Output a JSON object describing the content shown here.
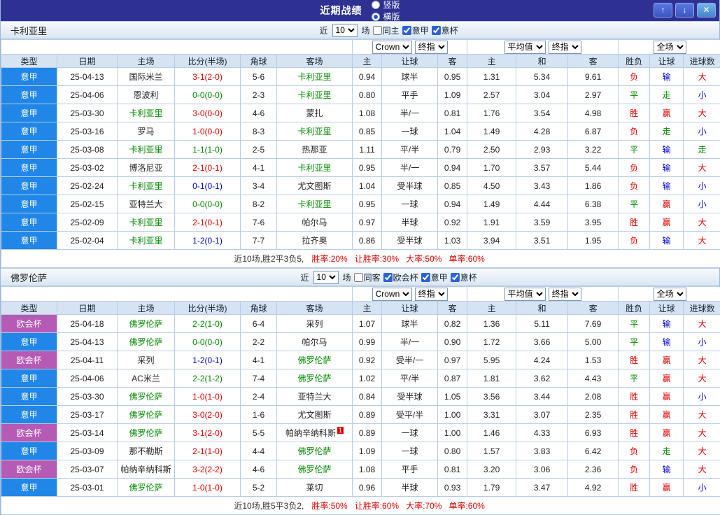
{
  "colors": {
    "titlebar_bg": "#2e3192",
    "header_bg": "#d6e3f2",
    "league_bg": {
      "意甲": "#2086e8",
      "欧会杯": "#b55ab5"
    },
    "win_red": "#e00000",
    "draw_green": "#008800",
    "lose_blue": "#0000cc"
  },
  "titlebar": {
    "title": "近期战绩",
    "radios": [
      {
        "name": "layout-vertical-radio",
        "label": "竖版",
        "selected": false
      },
      {
        "name": "layout-horizontal-radio",
        "label": "横版",
        "selected": true
      }
    ],
    "buttons": [
      {
        "name": "move-up-button",
        "icon": "up-arrow-icon",
        "glyph": "↑"
      },
      {
        "name": "move-down-button",
        "icon": "down-arrow-icon",
        "glyph": "↓"
      },
      {
        "name": "close-button",
        "icon": "close-icon",
        "glyph": "✕"
      }
    ]
  },
  "columns": [
    "类型",
    "日期",
    "主场",
    "比分(半场)",
    "角球",
    "客场",
    "主",
    "让球",
    "客",
    "主",
    "和",
    "客",
    "胜负",
    "让球",
    "进球数"
  ],
  "sections": [
    {
      "team": "卡利亚里",
      "controls": {
        "near_label": "近",
        "count": "10",
        "unit_label": "场",
        "checkboxes": [
          {
            "name": "same-home-checkbox",
            "label": "同主",
            "checked": false
          },
          {
            "name": "serie-a-checkbox",
            "label": "意甲",
            "checked": true
          },
          {
            "name": "italy-cup-checkbox",
            "label": "意杯",
            "checked": true
          }
        ]
      },
      "dropdowns": {
        "asian_source": "Crown",
        "asian_time": "终指",
        "euro_source": "平均值",
        "euro_time": "终指",
        "scope": "全场"
      },
      "rows": [
        {
          "league": "意甲",
          "date": "25-04-13",
          "home": "国际米兰",
          "home_focus": false,
          "score": "3-1(2-0)",
          "score_color": "red",
          "corners": "5-6",
          "away": "卡利亚里",
          "away_focus": true,
          "ah": [
            "0.94",
            "球半",
            "0.95"
          ],
          "eu": [
            "1.31",
            "5.34",
            "9.61"
          ],
          "result": [
            "负",
            "red"
          ],
          "handicap": [
            "输",
            "blue"
          ],
          "goals": [
            "大",
            "red"
          ]
        },
        {
          "league": "意甲",
          "date": "25-04-06",
          "home": "恩波利",
          "home_focus": false,
          "score": "0-0(0-0)",
          "score_color": "green",
          "corners": "2-3",
          "away": "卡利亚里",
          "away_focus": true,
          "ah": [
            "0.80",
            "平手",
            "1.09"
          ],
          "eu": [
            "2.57",
            "3.04",
            "2.97"
          ],
          "result": [
            "平",
            "green"
          ],
          "handicap": [
            "走",
            "green"
          ],
          "goals": [
            "小",
            "blue"
          ]
        },
        {
          "league": "意甲",
          "date": "25-03-30",
          "home": "卡利亚里",
          "home_focus": true,
          "score": "3-0(0-0)",
          "score_color": "red",
          "corners": "4-6",
          "away": "蒙扎",
          "away_focus": false,
          "ah": [
            "1.08",
            "半/一",
            "0.81"
          ],
          "eu": [
            "1.76",
            "3.54",
            "4.98"
          ],
          "result": [
            "胜",
            "red"
          ],
          "handicap": [
            "赢",
            "red"
          ],
          "goals": [
            "大",
            "red"
          ]
        },
        {
          "league": "意甲",
          "date": "25-03-16",
          "home": "罗马",
          "home_focus": false,
          "score": "1-0(0-0)",
          "score_color": "red",
          "corners": "8-3",
          "away": "卡利亚里",
          "away_focus": true,
          "ah": [
            "0.85",
            "一球",
            "1.04"
          ],
          "eu": [
            "1.49",
            "4.28",
            "6.87"
          ],
          "result": [
            "负",
            "red"
          ],
          "handicap": [
            "走",
            "green"
          ],
          "goals": [
            "小",
            "blue"
          ]
        },
        {
          "league": "意甲",
          "date": "25-03-08",
          "home": "卡利亚里",
          "home_focus": true,
          "score": "1-1(1-0)",
          "score_color": "green",
          "corners": "2-5",
          "away": "热那亚",
          "away_focus": false,
          "ah": [
            "1.11",
            "平/半",
            "0.79"
          ],
          "eu": [
            "2.50",
            "2.93",
            "3.22"
          ],
          "result": [
            "平",
            "green"
          ],
          "handicap": [
            "输",
            "blue"
          ],
          "goals": [
            "走",
            "green"
          ]
        },
        {
          "league": "意甲",
          "date": "25-03-02",
          "home": "博洛尼亚",
          "home_focus": false,
          "score": "2-1(0-1)",
          "score_color": "red",
          "corners": "4-1",
          "away": "卡利亚里",
          "away_focus": true,
          "ah": [
            "0.95",
            "半/一",
            "0.94"
          ],
          "eu": [
            "1.70",
            "3.57",
            "5.44"
          ],
          "result": [
            "负",
            "red"
          ],
          "handicap": [
            "输",
            "blue"
          ],
          "goals": [
            "大",
            "red"
          ]
        },
        {
          "league": "意甲",
          "date": "25-02-24",
          "home": "卡利亚里",
          "home_focus": true,
          "score": "0-1(0-1)",
          "score_color": "blue",
          "corners": "3-4",
          "away": "尤文图斯",
          "away_focus": false,
          "ah": [
            "1.04",
            "受半球",
            "0.85"
          ],
          "eu": [
            "4.50",
            "3.43",
            "1.86"
          ],
          "result": [
            "负",
            "red"
          ],
          "handicap": [
            "输",
            "blue"
          ],
          "goals": [
            "小",
            "blue"
          ]
        },
        {
          "league": "意甲",
          "date": "25-02-15",
          "home": "亚特兰大",
          "home_focus": false,
          "score": "0-0(0-0)",
          "score_color": "green",
          "corners": "8-2",
          "away": "卡利亚里",
          "away_focus": true,
          "ah": [
            "0.95",
            "一球",
            "0.94"
          ],
          "eu": [
            "1.49",
            "4.44",
            "6.38"
          ],
          "result": [
            "平",
            "green"
          ],
          "handicap": [
            "赢",
            "red"
          ],
          "goals": [
            "小",
            "blue"
          ]
        },
        {
          "league": "意甲",
          "date": "25-02-09",
          "home": "卡利亚里",
          "home_focus": true,
          "score": "2-1(0-1)",
          "score_color": "red",
          "corners": "7-6",
          "away": "帕尔马",
          "away_focus": false,
          "ah": [
            "0.97",
            "半球",
            "0.92"
          ],
          "eu": [
            "1.91",
            "3.59",
            "3.95"
          ],
          "result": [
            "胜",
            "red"
          ],
          "handicap": [
            "赢",
            "red"
          ],
          "goals": [
            "大",
            "red"
          ]
        },
        {
          "league": "意甲",
          "date": "25-02-04",
          "home": "卡利亚里",
          "home_focus": true,
          "score": "1-2(0-1)",
          "score_color": "blue",
          "corners": "7-7",
          "away": "拉齐奥",
          "away_focus": false,
          "ah": [
            "0.86",
            "受半球",
            "1.03"
          ],
          "eu": [
            "3.94",
            "3.51",
            "1.95"
          ],
          "result": [
            "负",
            "red"
          ],
          "handicap": [
            "输",
            "blue"
          ],
          "goals": [
            "大",
            "red"
          ]
        }
      ],
      "summary": {
        "prefix": "近10场,胜2平3负5,",
        "stats": [
          "胜率:20%",
          "让胜率:30%",
          "大率:50%",
          "单率:60%"
        ]
      }
    },
    {
      "team": "佛罗伦萨",
      "controls": {
        "near_label": "近",
        "count": "10",
        "unit_label": "场",
        "checkboxes": [
          {
            "name": "same-away-checkbox",
            "label": "同客",
            "checked": false
          },
          {
            "name": "conference-league-checkbox",
            "label": "欧会杯",
            "checked": true
          },
          {
            "name": "serie-a-checkbox",
            "label": "意甲",
            "checked": true
          },
          {
            "name": "italy-cup-checkbox",
            "label": "意杯",
            "checked": true
          }
        ]
      },
      "dropdowns": {
        "asian_source": "Crown",
        "asian_time": "终指",
        "euro_source": "平均值",
        "euro_time": "终指",
        "scope": "全场"
      },
      "rows": [
        {
          "league": "欧会杯",
          "date": "25-04-18",
          "home": "佛罗伦萨",
          "home_focus": true,
          "score": "2-2(1-0)",
          "score_color": "green",
          "corners": "6-4",
          "away": "采列",
          "away_focus": false,
          "ah": [
            "1.07",
            "球半",
            "0.82"
          ],
          "eu": [
            "1.36",
            "5.11",
            "7.69"
          ],
          "result": [
            "平",
            "green"
          ],
          "handicap": [
            "输",
            "blue"
          ],
          "goals": [
            "大",
            "red"
          ]
        },
        {
          "league": "意甲",
          "date": "25-04-13",
          "home": "佛罗伦萨",
          "home_focus": true,
          "score": "0-0(0-0)",
          "score_color": "green",
          "corners": "2-2",
          "away": "帕尔马",
          "away_focus": false,
          "ah": [
            "0.99",
            "半/一",
            "0.90"
          ],
          "eu": [
            "1.72",
            "3.66",
            "5.00"
          ],
          "result": [
            "平",
            "green"
          ],
          "handicap": [
            "输",
            "blue"
          ],
          "goals": [
            "小",
            "blue"
          ]
        },
        {
          "league": "欧会杯",
          "date": "25-04-11",
          "home": "采列",
          "home_focus": false,
          "score": "1-2(0-1)",
          "score_color": "blue",
          "corners": "4-1",
          "away": "佛罗伦萨",
          "away_focus": true,
          "ah": [
            "0.92",
            "受半/一",
            "0.97"
          ],
          "eu": [
            "5.95",
            "4.24",
            "1.53"
          ],
          "result": [
            "胜",
            "red"
          ],
          "handicap": [
            "赢",
            "red"
          ],
          "goals": [
            "大",
            "red"
          ]
        },
        {
          "league": "意甲",
          "date": "25-04-06",
          "home": "AC米兰",
          "home_focus": false,
          "score": "2-2(1-2)",
          "score_color": "green",
          "corners": "7-4",
          "away": "佛罗伦萨",
          "away_focus": true,
          "ah": [
            "1.02",
            "平/半",
            "0.87"
          ],
          "eu": [
            "1.81",
            "3.62",
            "4.43"
          ],
          "result": [
            "平",
            "green"
          ],
          "handicap": [
            "赢",
            "red"
          ],
          "goals": [
            "大",
            "red"
          ]
        },
        {
          "league": "意甲",
          "date": "25-03-30",
          "home": "佛罗伦萨",
          "home_focus": true,
          "score": "1-0(1-0)",
          "score_color": "red",
          "corners": "2-4",
          "away": "亚特兰大",
          "away_focus": false,
          "ah": [
            "0.84",
            "受半球",
            "1.05"
          ],
          "eu": [
            "3.56",
            "3.44",
            "2.08"
          ],
          "result": [
            "胜",
            "red"
          ],
          "handicap": [
            "赢",
            "red"
          ],
          "goals": [
            "小",
            "blue"
          ]
        },
        {
          "league": "意甲",
          "date": "25-03-17",
          "home": "佛罗伦萨",
          "home_focus": true,
          "score": "3-0(2-0)",
          "score_color": "red",
          "corners": "1-6",
          "away": "尤文图斯",
          "away_focus": false,
          "ah": [
            "0.89",
            "受平/半",
            "1.00"
          ],
          "eu": [
            "3.31",
            "3.07",
            "2.35"
          ],
          "result": [
            "胜",
            "red"
          ],
          "handicap": [
            "赢",
            "red"
          ],
          "goals": [
            "大",
            "red"
          ]
        },
        {
          "league": "欧会杯",
          "date": "25-03-14",
          "home": "佛罗伦萨",
          "home_focus": true,
          "score": "3-1(2-0)",
          "score_color": "red",
          "corners": "5-5",
          "away": "帕纳辛纳科斯",
          "away_focus": false,
          "note": "1",
          "ah": [
            "0.89",
            "一球",
            "1.00"
          ],
          "eu": [
            "1.46",
            "4.33",
            "6.93"
          ],
          "result": [
            "胜",
            "red"
          ],
          "handicap": [
            "赢",
            "red"
          ],
          "goals": [
            "大",
            "red"
          ]
        },
        {
          "league": "意甲",
          "date": "25-03-09",
          "home": "那不勒斯",
          "home_focus": false,
          "score": "2-1(1-0)",
          "score_color": "red",
          "corners": "4-4",
          "away": "佛罗伦萨",
          "away_focus": true,
          "ah": [
            "1.09",
            "一球",
            "0.80"
          ],
          "eu": [
            "1.57",
            "3.83",
            "6.42"
          ],
          "result": [
            "负",
            "red"
          ],
          "handicap": [
            "走",
            "green"
          ],
          "goals": [
            "大",
            "red"
          ]
        },
        {
          "league": "欧会杯",
          "date": "25-03-07",
          "home": "帕纳辛纳科斯",
          "home_focus": false,
          "score": "3-2(2-2)",
          "score_color": "red",
          "corners": "4-6",
          "away": "佛罗伦萨",
          "away_focus": true,
          "ah": [
            "1.08",
            "平手",
            "0.81"
          ],
          "eu": [
            "3.20",
            "3.06",
            "2.36"
          ],
          "result": [
            "负",
            "red"
          ],
          "handicap": [
            "输",
            "blue"
          ],
          "goals": [
            "大",
            "red"
          ]
        },
        {
          "league": "意甲",
          "date": "25-03-01",
          "home": "佛罗伦萨",
          "home_focus": true,
          "score": "1-0(1-0)",
          "score_color": "red",
          "corners": "5-2",
          "away": "莱切",
          "away_focus": false,
          "ah": [
            "0.96",
            "半球",
            "0.93"
          ],
          "eu": [
            "1.79",
            "3.47",
            "4.92"
          ],
          "result": [
            "胜",
            "red"
          ],
          "handicap": [
            "赢",
            "red"
          ],
          "goals": [
            "小",
            "blue"
          ]
        }
      ],
      "summary": {
        "prefix": "近10场,胜5平3负2,",
        "stats": [
          "胜率:50%",
          "让胜率:60%",
          "大率:70%",
          "单率:60%"
        ]
      }
    }
  ]
}
